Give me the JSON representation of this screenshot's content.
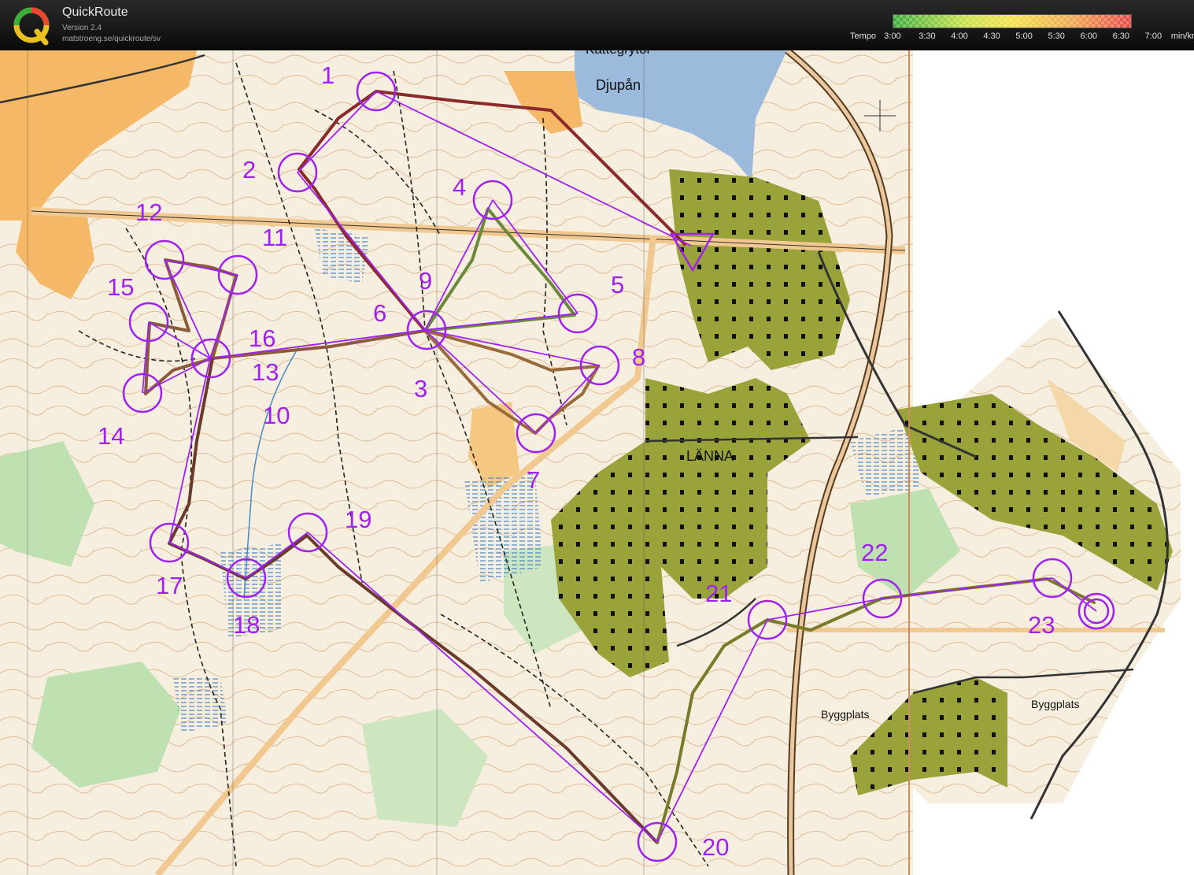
{
  "app": {
    "title": "QuickRoute",
    "version": "Version 2.4",
    "url": "matstroeng.se/quickroute/sv"
  },
  "tempo": {
    "caption": "Tempo",
    "ticks": [
      "3:00",
      "3:30",
      "4:00",
      "4:30",
      "5:00",
      "5:30",
      "6:00",
      "6:30",
      "7:00"
    ],
    "unit": "min/km",
    "colors": [
      "#3cae3c",
      "#c8e04a",
      "#f2e24a",
      "#f0a850",
      "#e84a4a"
    ]
  },
  "map": {
    "place_names": {
      "djupan": "Djupån",
      "kattegrytor": "Kattegrytor",
      "lanna": "LÄNNA",
      "byggplats_west": "Byggplats",
      "byggplats_east": "Byggplats"
    },
    "controls": [
      "1",
      "2",
      "3",
      "4",
      "5",
      "6",
      "7",
      "8",
      "9",
      "10",
      "11",
      "12",
      "13",
      "14",
      "15",
      "16",
      "17",
      "18",
      "19",
      "20",
      "21",
      "22",
      "23"
    ],
    "course_color": "#a020f0"
  }
}
